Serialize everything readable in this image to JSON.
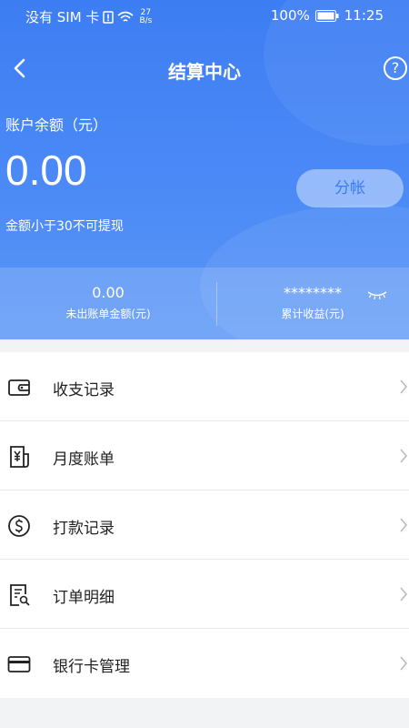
{
  "status_bar": {
    "carrier": "没有 SIM 卡",
    "speed_value": "27",
    "speed_unit": "B/s",
    "battery": "100%",
    "time": "11:25"
  },
  "nav": {
    "title": "结算中心",
    "help_icon": "?"
  },
  "balance": {
    "label": "账户余额（元）",
    "amount": "0.00",
    "split_button": "分帐",
    "tip": "金额小于30不可提现"
  },
  "stats": {
    "unbilled_value": "0.00",
    "unbilled_label": "未出账单金额(元)",
    "earnings_value": "********",
    "earnings_label": "累计收益(元)"
  },
  "menu": [
    {
      "label": "收支记录",
      "icon": "wallet-icon"
    },
    {
      "label": "月度账单",
      "icon": "bill-icon"
    },
    {
      "label": "打款记录",
      "icon": "dollar-icon"
    },
    {
      "label": "订单明细",
      "icon": "order-search-icon"
    },
    {
      "label": "银行卡管理",
      "icon": "bank-card-icon"
    }
  ],
  "colors": {
    "primary": "#3d7df3",
    "background": "#f2f3f5"
  }
}
